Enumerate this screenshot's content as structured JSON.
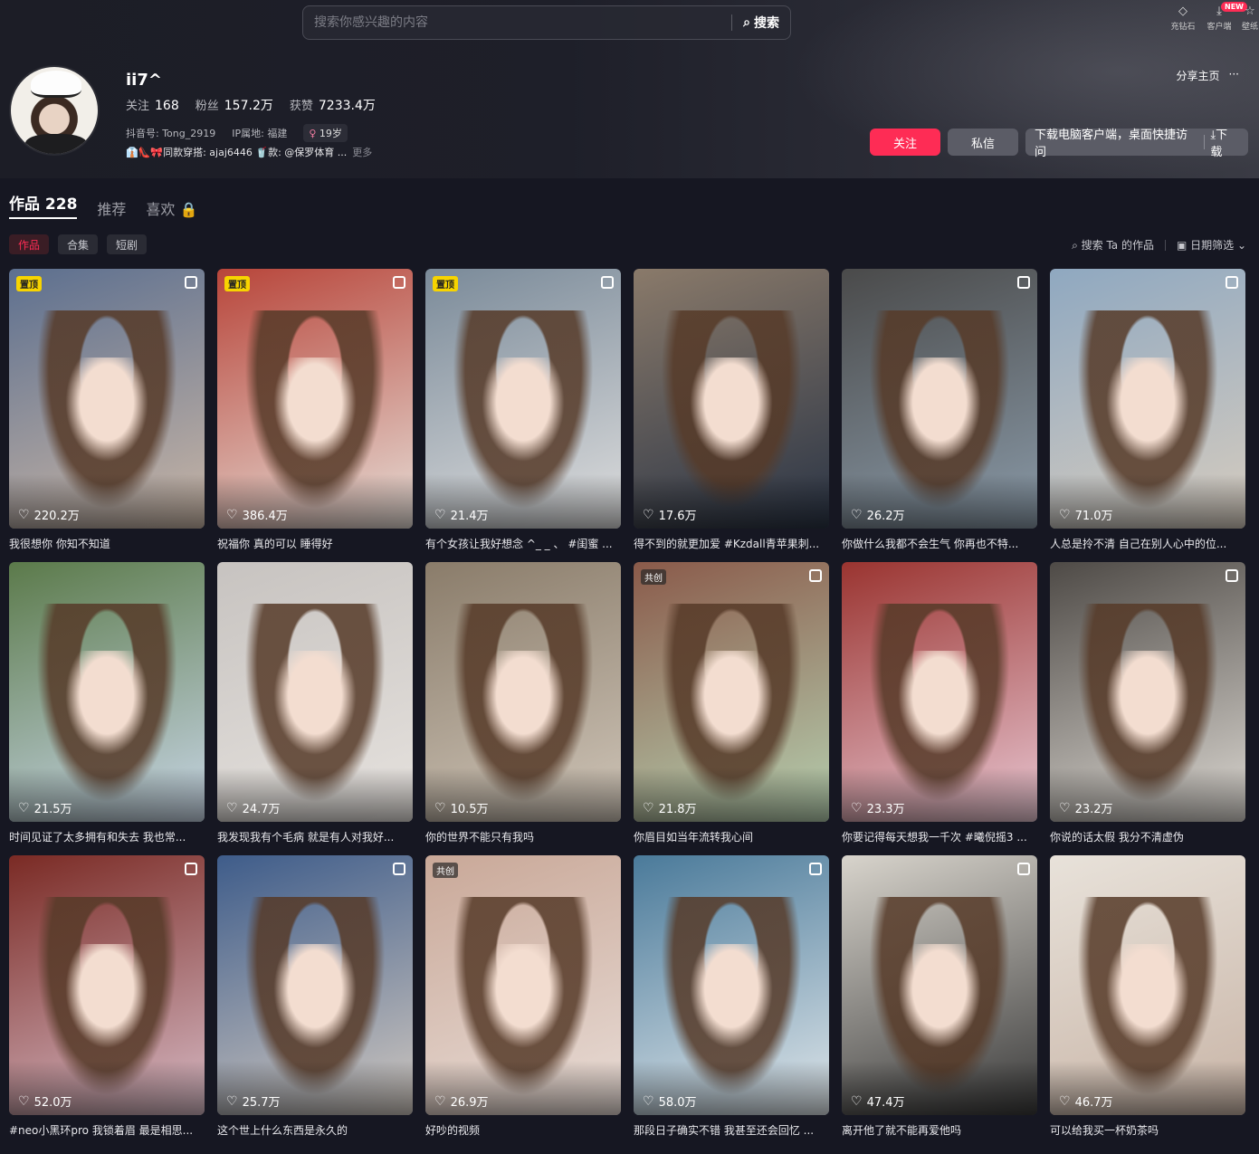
{
  "search": {
    "placeholder": "搜索你感兴趣的内容",
    "button_label": "搜索"
  },
  "top_actions": [
    {
      "label": "充钻石",
      "icon": "diamond-icon"
    },
    {
      "label": "客户端",
      "icon": "download-icon",
      "badge": "NEW"
    },
    {
      "label": "壁纸",
      "icon": "wallpaper-icon"
    }
  ],
  "profile": {
    "nickname": "ii7^",
    "following_label": "关注",
    "following": "168",
    "followers_label": "粉丝",
    "followers": "157.2万",
    "likes_label": "获赞",
    "likes": "7233.4万",
    "douyin_id": "抖音号: Tong_2919",
    "ip": "IP属地: 福建",
    "age": "19岁",
    "signature": "👔👠🎀同款穿搭: ajaj6446 🥤款: @保罗体育 ...",
    "more": "更多",
    "share": "分享主页",
    "share_more": "···"
  },
  "actions": {
    "follow": "关注",
    "message": "私信",
    "download_text": "下载电脑客户端，桌面快捷访问",
    "download_btn": "⤓下载"
  },
  "tabs": [
    {
      "label": "作品 228",
      "active": true
    },
    {
      "label": "推荐",
      "active": false
    },
    {
      "label": "喜欢 🔒",
      "active": false
    }
  ],
  "subtabs": [
    {
      "label": "作品",
      "active": true
    },
    {
      "label": "合集",
      "active": false
    },
    {
      "label": "短剧",
      "active": false
    }
  ],
  "filters": {
    "search_works": "搜索 Ta 的作品",
    "date_filter": "日期筛选"
  },
  "videos": [
    {
      "likes": "220.2万",
      "caption": "我很想你 你知不知道",
      "pinned": "置顶",
      "multi": true,
      "colors": [
        "#5c6f8f",
        "#c9b6a6"
      ]
    },
    {
      "likes": "386.4万",
      "caption": "祝福你 真的可以 睡得好",
      "pinned": "置顶",
      "multi": true,
      "colors": [
        "#b8453a",
        "#e6ddd6"
      ]
    },
    {
      "likes": "21.4万",
      "caption": "有个女孩让我好想念 ^_ _ 、 #闺蜜 ...",
      "pinned": "置顶",
      "multi": true,
      "colors": [
        "#7a8a99",
        "#dedede"
      ]
    },
    {
      "likes": "17.6万",
      "caption": "得不到的就更加爱 #Kzdall青苹果刺...",
      "pinned": "",
      "multi": false,
      "colors": [
        "#8a7a6a",
        "#2a3445"
      ]
    },
    {
      "likes": "26.2万",
      "caption": "你做什么我都不会生气 你再也不特...",
      "pinned": "",
      "multi": true,
      "colors": [
        "#4a4a4a",
        "#8a9aa8"
      ]
    },
    {
      "likes": "71.0万",
      "caption": "人总是拎不清 自己在别人心中的位...",
      "pinned": "",
      "multi": true,
      "colors": [
        "#8fa8c0",
        "#d6ccbf"
      ]
    },
    {
      "likes": "21.5万",
      "caption": "时间见证了太多拥有和失去 我也常...",
      "pinned": "",
      "multi": false,
      "colors": [
        "#5b7a4a",
        "#c8d6e6"
      ]
    },
    {
      "likes": "24.7万",
      "caption": "我发现我有个毛病 就是有人对我好...",
      "pinned": "",
      "multi": false,
      "colors": [
        "#c7c3c0",
        "#e6e2de"
      ]
    },
    {
      "likes": "10.5万",
      "caption": "你的世界不能只有我吗",
      "pinned": "",
      "multi": false,
      "colors": [
        "#8a7c6a",
        "#cfc5b8"
      ]
    },
    {
      "likes": "21.8万",
      "caption": "你眉目如当年流转我心间",
      "pinned": "",
      "collab": "共创",
      "multi": true,
      "colors": [
        "#8a5a4a",
        "#b6d0b0"
      ]
    },
    {
      "likes": "23.3万",
      "caption": "你要记得每天想我一千次 #曦倪摇3 ...",
      "pinned": "",
      "multi": false,
      "colors": [
        "#9a3430",
        "#e8c6d2"
      ]
    },
    {
      "likes": "23.2万",
      "caption": "你说的话太假 我分不清虚伪",
      "pinned": "",
      "multi": true,
      "colors": [
        "#4e4a46",
        "#dcd8d2"
      ]
    },
    {
      "likes": "52.0万",
      "caption": "#neo小黑环pro 我锁着眉 最是相思...",
      "pinned": "",
      "multi": true,
      "colors": [
        "#7a2a24",
        "#d6b9c4"
      ]
    },
    {
      "likes": "25.7万",
      "caption": "这个世上什么东西是永久的",
      "pinned": "",
      "multi": true,
      "colors": [
        "#3e5c8a",
        "#d0c8c0"
      ]
    },
    {
      "likes": "26.9万",
      "caption": "好吵的视频",
      "pinned": "",
      "collab": "共创",
      "multi": false,
      "colors": [
        "#c9a898",
        "#e8dcd6"
      ]
    },
    {
      "likes": "58.0万",
      "caption": "那段日子确实不错 我甚至还会回忆 ...",
      "pinned": "",
      "multi": true,
      "colors": [
        "#4a7a9a",
        "#dfe6ea"
      ]
    },
    {
      "likes": "47.4万",
      "caption": "离开他了就不能再爱他吗",
      "pinned": "",
      "multi": true,
      "colors": [
        "#d8d4cc",
        "#3a3a3a"
      ]
    },
    {
      "likes": "46.7万",
      "caption": "可以给我买一杯奶茶吗",
      "pinned": "",
      "multi": false,
      "colors": [
        "#e8e2da",
        "#c8b4a6"
      ]
    }
  ]
}
